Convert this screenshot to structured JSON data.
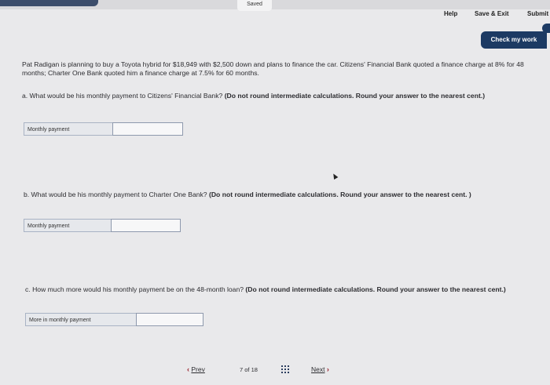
{
  "header": {
    "saved": "Saved",
    "help": "Help",
    "save_exit": "Save & Exit",
    "submit": "Submit",
    "check_my_work": "Check my work"
  },
  "problem": {
    "intro": "Pat Radigan is planning to buy a Toyota hybrid for $18,949 with $2,500 down and plans to finance the car. Citizens' Financial Bank quoted a finance charge at 8% for 48 months; Charter One Bank quoted him a finance charge at 7.5% for 60 months.",
    "a_prompt": "a. What would be his monthly payment to Citizens' Financial Bank?",
    "a_instruction": "(Do not round intermediate calculations. Round your answer to the nearest cent.)",
    "a_label": "Monthly payment",
    "a_value": "",
    "b_prompt": "b. What would be his monthly payment to Charter One Bank?",
    "b_instruction": "(Do not round intermediate calculations. Round your answer to the nearest cent. )",
    "b_label": "Monthly payment",
    "b_value": "",
    "c_prompt": "c. How much more would his monthly payment be on the 48-month loan?",
    "c_instruction": "(Do not round intermediate calculations. Round your answer to the nearest cent.)",
    "c_label": "More in monthly payment",
    "c_value": ""
  },
  "nav": {
    "prev": "Prev",
    "current": "7",
    "of": "of",
    "total": "18",
    "next": "Next"
  },
  "icons": {
    "prev": "chevron-left-icon",
    "next": "chevron-right-icon",
    "grid": "grid-icon"
  },
  "colors": {
    "accent": "#1c3a63",
    "chevron": "#9a1f2b"
  }
}
